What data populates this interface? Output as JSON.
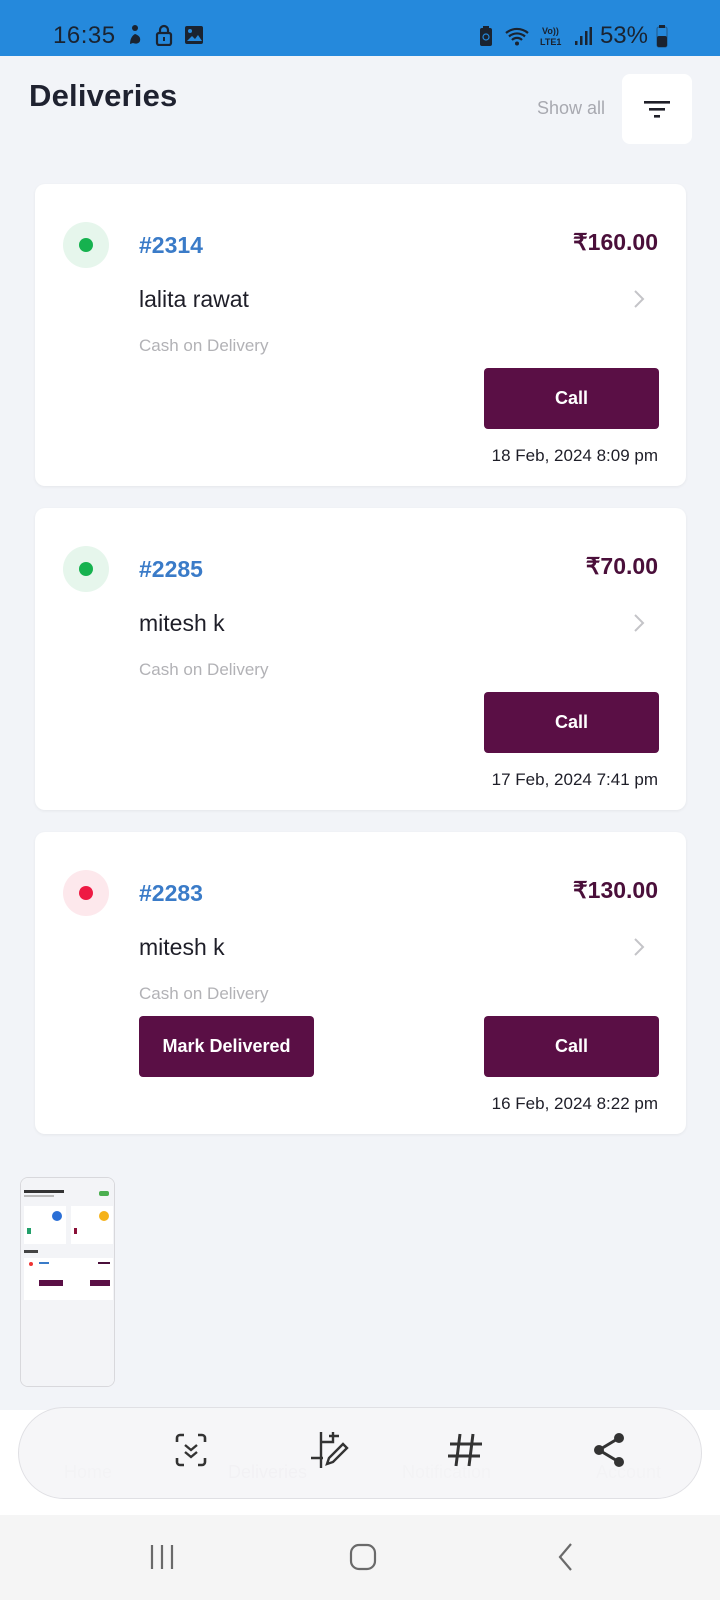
{
  "status_bar": {
    "time": "16:35",
    "left_icons": [
      "accessibility-icon",
      "lock-icon",
      "image-icon"
    ],
    "right_icons": [
      "battery-saver-icon",
      "wifi-icon",
      "volte-lte-icon",
      "signal-icon"
    ],
    "battery_percent": "53%",
    "network_label_top": "Vo))",
    "network_label_bottom": "LTE1"
  },
  "header": {
    "title": "Deliveries",
    "show_all_label": "Show all",
    "filter_icon": "filter-icon"
  },
  "deliveries": [
    {
      "order_id": "#2314",
      "amount": "₹160.00",
      "customer": "lalita rawat",
      "payment": "Cash on Delivery",
      "status": "delivered",
      "status_color": "#16b24f",
      "status_bg": "#e6f6ec",
      "call_label": "Call",
      "mark_delivered_label": null,
      "datetime": "18 Feb, 2024 8:09 pm"
    },
    {
      "order_id": "#2285",
      "amount": "₹70.00",
      "customer": "mitesh k",
      "payment": "Cash on Delivery",
      "status": "delivered",
      "status_color": "#16b24f",
      "status_bg": "#e6f6ec",
      "call_label": "Call",
      "mark_delivered_label": null,
      "datetime": "17 Feb, 2024 7:41 pm"
    },
    {
      "order_id": "#2283",
      "amount": "₹130.00",
      "customer": "mitesh k",
      "payment": "Cash on Delivery",
      "status": "pending",
      "status_color": "#ee1a43",
      "status_bg": "#fde8ec",
      "call_label": "Call",
      "mark_delivered_label": "Mark Delivered",
      "datetime": "16 Feb, 2024 8:22 pm"
    }
  ],
  "bottom_nav": {
    "items": [
      {
        "label": "Home"
      },
      {
        "label": "Deliveries"
      },
      {
        "label": "Notification"
      },
      {
        "label": "Account"
      }
    ]
  },
  "screenshot_toolbar": {
    "tools": [
      "scroll-capture-icon",
      "crop-edit-icon",
      "hashtag-icon",
      "share-icon"
    ]
  },
  "colors": {
    "accent": "#5a0f45",
    "link": "#3a7bc8",
    "status_bar": "#2589dc"
  }
}
